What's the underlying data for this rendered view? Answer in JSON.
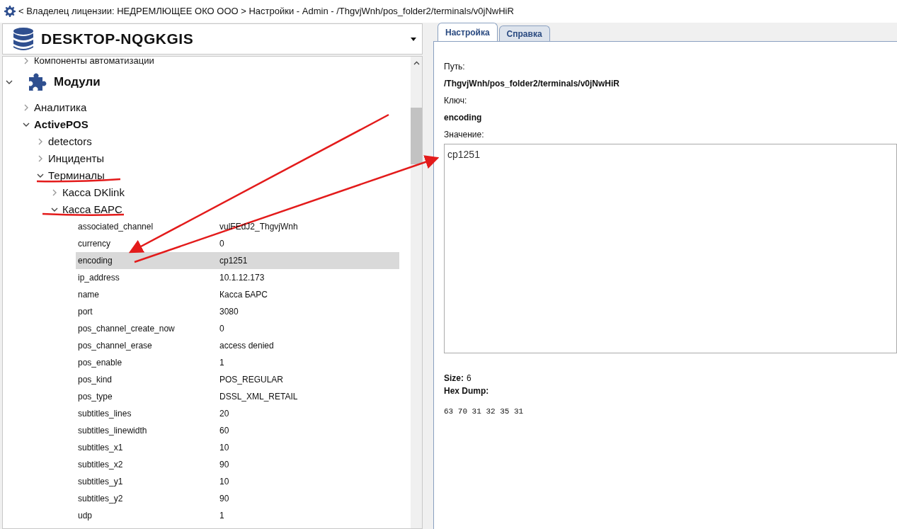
{
  "title_bar": {
    "text": "< Владелец лицензии: НЕДРЕМЛЮЩЕЕ ОКО ООО > Настройки - Admin - /ThgvjWnh/pos_folder2/terminals/v0jNwHiR"
  },
  "server_select": {
    "value": "DESKTOP-NQGKGIS"
  },
  "tree": {
    "partial_item": {
      "label": "Компоненты автоматизации",
      "expanded": false
    },
    "items": [
      {
        "label": "Модули",
        "kind": "module",
        "expanded": true,
        "children": [
          {
            "label": "Аналитика",
            "expanded": false
          },
          {
            "label": "ActivePOS",
            "bold": true,
            "expanded": true,
            "children": [
              {
                "label": "detectors",
                "expanded": false
              },
              {
                "label": "Инциденты",
                "expanded": false
              },
              {
                "label": "Терминалы",
                "expanded": true,
                "children": [
                  {
                    "label": "Касса DKlink",
                    "expanded": false
                  },
                  {
                    "label": "Касса БАРС",
                    "expanded": true,
                    "properties": [
                      {
                        "key": "associated_channel",
                        "value": "vulFEdJ2_ThgvjWnh",
                        "selected": false
                      },
                      {
                        "key": "currency",
                        "value": "0",
                        "selected": false
                      },
                      {
                        "key": "encoding",
                        "value": "cp1251",
                        "selected": true
                      },
                      {
                        "key": "ip_address",
                        "value": "10.1.12.173",
                        "selected": false
                      },
                      {
                        "key": "name",
                        "value": "Касса БАРС",
                        "selected": false
                      },
                      {
                        "key": "port",
                        "value": "3080",
                        "selected": false
                      },
                      {
                        "key": "pos_channel_create_now",
                        "value": "0",
                        "selected": false
                      },
                      {
                        "key": "pos_channel_erase",
                        "value": "access denied",
                        "selected": false
                      },
                      {
                        "key": "pos_enable",
                        "value": "1",
                        "selected": false
                      },
                      {
                        "key": "pos_kind",
                        "value": "POS_REGULAR",
                        "selected": false
                      },
                      {
                        "key": "pos_type",
                        "value": "DSSL_XML_RETAIL",
                        "selected": false
                      },
                      {
                        "key": "subtitles_lines",
                        "value": "20",
                        "selected": false
                      },
                      {
                        "key": "subtitles_linewidth",
                        "value": "60",
                        "selected": false
                      },
                      {
                        "key": "subtitles_x1",
                        "value": "10",
                        "selected": false
                      },
                      {
                        "key": "subtitles_x2",
                        "value": "90",
                        "selected": false
                      },
                      {
                        "key": "subtitles_y1",
                        "value": "10",
                        "selected": false
                      },
                      {
                        "key": "subtitles_y2",
                        "value": "90",
                        "selected": false
                      },
                      {
                        "key": "udp",
                        "value": "1",
                        "selected": false
                      }
                    ]
                  }
                ]
              }
            ]
          }
        ]
      }
    ]
  },
  "tabs": [
    {
      "label": "Настройка",
      "selected": true
    },
    {
      "label": "Справка",
      "selected": false
    }
  ],
  "details": {
    "path_label": "Путь:",
    "path": "/ThgvjWnh/pos_folder2/terminals/v0jNwHiR",
    "key_label": "Ключ:",
    "key": "encoding",
    "value_label": "Значение:",
    "value": "cp1251",
    "size_label": "Size:",
    "size": "6",
    "hex_label": "Hex Dump:",
    "hex": "63 70 31 32 35 31"
  }
}
